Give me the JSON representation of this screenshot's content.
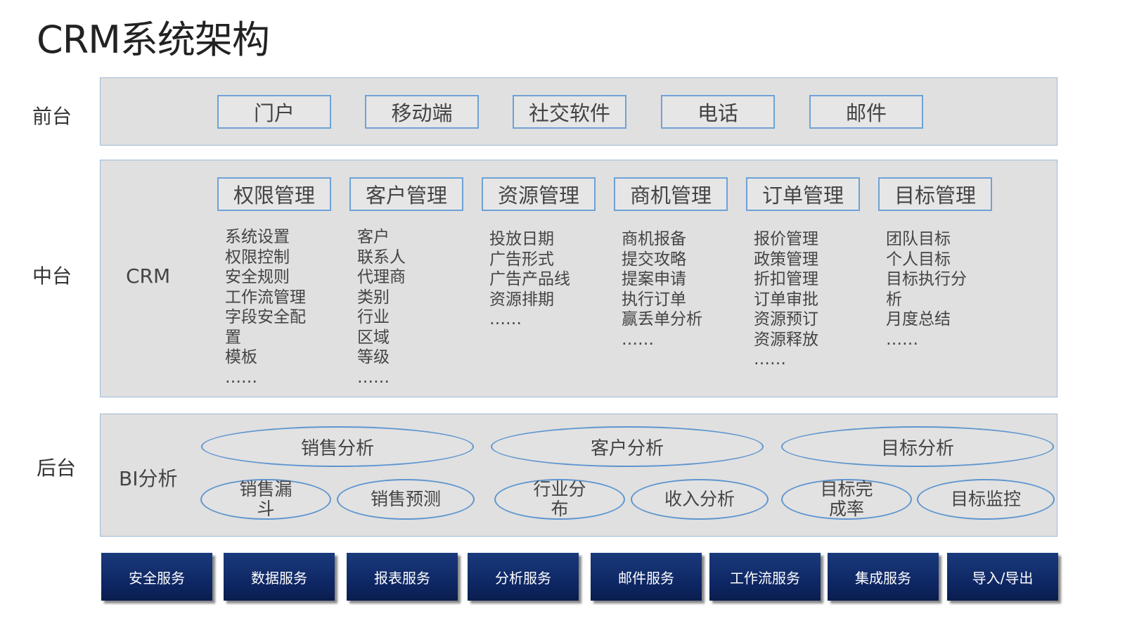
{
  "title": "CRM系统架构",
  "layers": {
    "front": "前台",
    "middle": "中台",
    "back": "后台"
  },
  "front": {
    "items": [
      "门户",
      "移动端",
      "社交软件",
      "电话",
      "邮件"
    ]
  },
  "middle": {
    "label": "CRM",
    "modules": [
      {
        "name": "权限管理",
        "items": [
          "系统设置",
          "权限控制",
          "安全规则",
          "工作流管理",
          "字段安全配",
          "置",
          "模板",
          "……"
        ]
      },
      {
        "name": "客户管理",
        "items": [
          "客户",
          "联系人",
          "代理商",
          "类别",
          "行业",
          "区域",
          "等级",
          "……"
        ]
      },
      {
        "name": "资源管理",
        "items": [
          "投放日期",
          "广告形式",
          "广告产品线",
          "资源排期",
          "……"
        ]
      },
      {
        "name": "商机管理",
        "items": [
          "商机报备",
          "提交攻略",
          "提案申请",
          "执行订单",
          "赢丢单分析",
          "……"
        ]
      },
      {
        "name": "订单管理",
        "items": [
          "报价管理",
          "政策管理",
          "折扣管理",
          "订单审批",
          "资源预订",
          "资源释放",
          "……"
        ]
      },
      {
        "name": "目标管理",
        "items": [
          "团队目标",
          "个人目标",
          "目标执行分",
          "析",
          "月度总结",
          "……"
        ]
      }
    ]
  },
  "back": {
    "label": "BI分析",
    "groups": [
      {
        "name": "销售分析",
        "subs": [
          "销售漏\n斗",
          "销售预测"
        ]
      },
      {
        "name": "客户分析",
        "subs": [
          "行业分\n布",
          "收入分析"
        ]
      },
      {
        "name": "目标分析",
        "subs": [
          "目标完\n成率",
          "目标监控"
        ]
      }
    ]
  },
  "services": [
    "安全服务",
    "数据服务",
    "报表服务",
    "分析服务",
    "邮件服务",
    "工作流服务",
    "集成服务",
    "导入/导出"
  ]
}
